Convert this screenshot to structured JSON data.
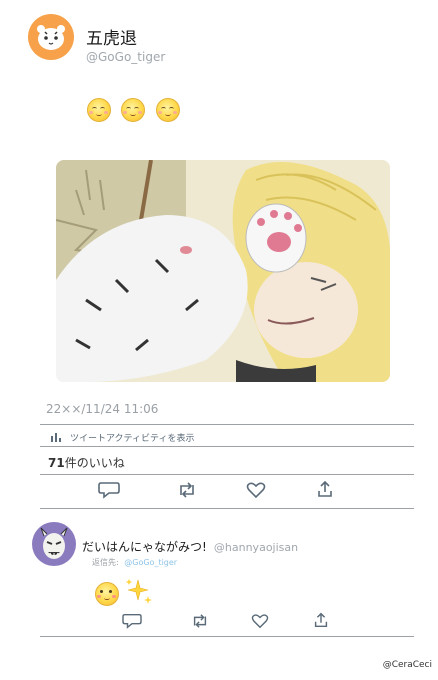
{
  "tweet": {
    "author_name": "五虎退",
    "author_handle": "@GoGo_tiger",
    "timestamp": "22××/11/24 11:06",
    "activity_label": "ツイートアクティビティを表示",
    "likes_count": "71",
    "likes_suffix": "件のいいね"
  },
  "reply": {
    "author_name": "だいはんにゃながみつ!",
    "author_handle": "@hannyaojisan",
    "replying_prefix": "返信先:",
    "replying_to": "@GoGo_tiger"
  },
  "credit": "@CeraCeci",
  "colors": {
    "avatar_bg": "#f7a24a",
    "reply_avatar_bg": "#8a7bbf",
    "link": "#8fc3e8",
    "divider": "#9ea2a6",
    "icon": "#5a6a78"
  }
}
